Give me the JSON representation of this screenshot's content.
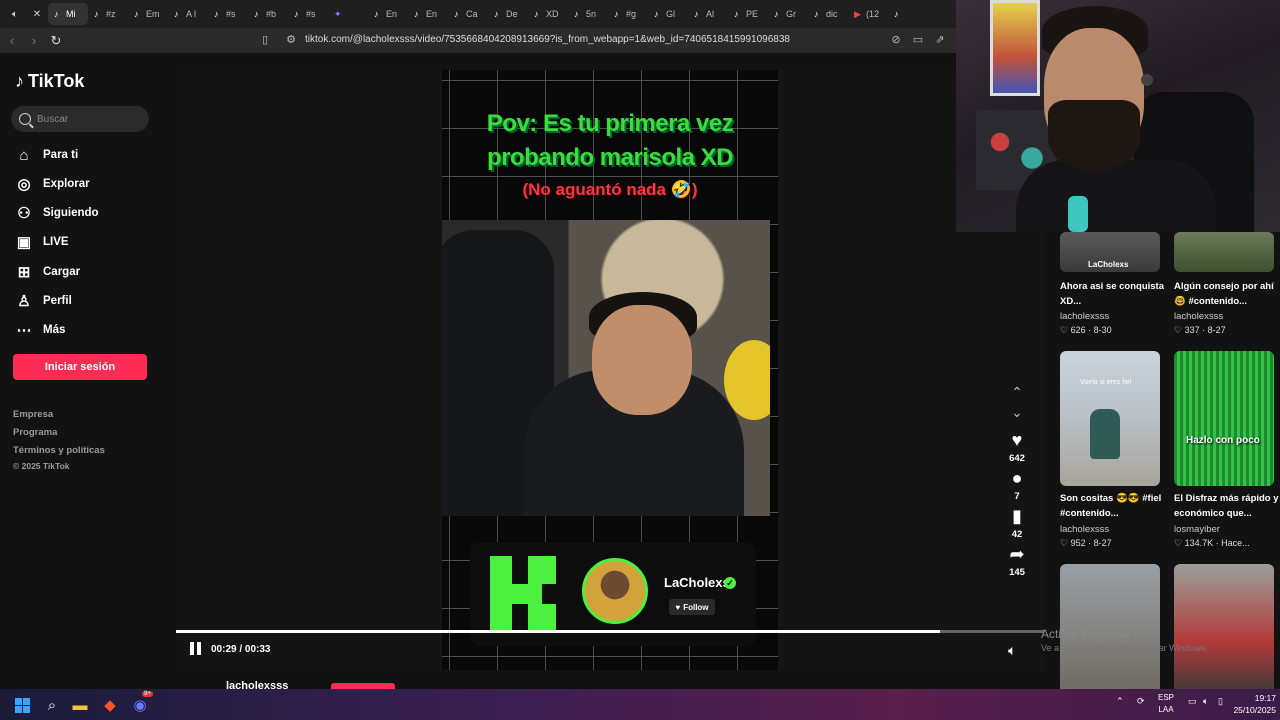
{
  "browser": {
    "tabs": [
      {
        "label": "",
        "icon": "speaker-icon"
      },
      {
        "label": "",
        "icon": "close-icon"
      },
      {
        "label": "Mi",
        "icon": "tiktok-icon",
        "active": true
      },
      {
        "label": "#z",
        "icon": "tiktok-icon"
      },
      {
        "label": "Em",
        "icon": "tiktok-icon"
      },
      {
        "label": "A l",
        "icon": "tiktok-icon"
      },
      {
        "label": "#s",
        "icon": "tiktok-icon"
      },
      {
        "label": "#b",
        "icon": "tiktok-icon"
      },
      {
        "label": "#s",
        "icon": "tiktok-icon"
      },
      {
        "label": "",
        "icon": "twitch-icon"
      },
      {
        "label": "En",
        "icon": "tiktok-icon"
      },
      {
        "label": "En",
        "icon": "tiktok-icon"
      },
      {
        "label": "Ca",
        "icon": "tiktok-icon"
      },
      {
        "label": "De",
        "icon": "tiktok-icon"
      },
      {
        "label": "XD",
        "icon": "tiktok-icon"
      },
      {
        "label": "5n",
        "icon": "tiktok-icon"
      },
      {
        "label": "#g",
        "icon": "tiktok-icon"
      },
      {
        "label": "Gl",
        "icon": "tiktok-icon"
      },
      {
        "label": "Al",
        "icon": "tiktok-icon"
      },
      {
        "label": "PE",
        "icon": "tiktok-icon"
      },
      {
        "label": "Gr",
        "icon": "tiktok-icon"
      },
      {
        "label": "dic",
        "icon": "tiktok-icon"
      },
      {
        "label": "(12",
        "icon": "youtube-icon"
      },
      {
        "label": "",
        "icon": "tiktok-icon"
      }
    ],
    "url": "tiktok.com/@lacholexsss/video/7535668404208913669?is_from_webapp=1&web_id=7406518415991096838"
  },
  "sidebar": {
    "logo": "TikTok",
    "search_placeholder": "Buscar",
    "nav": [
      {
        "label": "Para ti",
        "icon": "home-icon"
      },
      {
        "label": "Explorar",
        "icon": "compass-icon"
      },
      {
        "label": "Siguiendo",
        "icon": "following-icon"
      },
      {
        "label": "LIVE",
        "icon": "live-icon"
      },
      {
        "label": "Cargar",
        "icon": "upload-icon"
      },
      {
        "label": "Perfil",
        "icon": "profile-icon"
      },
      {
        "label": "Más",
        "icon": "more-icon"
      }
    ],
    "login_label": "Iniciar sesión",
    "footer": [
      "Empresa",
      "Programa",
      "Términos y políticas"
    ],
    "copyright": "© 2025 TikTok"
  },
  "video": {
    "overlay_line1": "Pov: Es tu primera vez",
    "overlay_line2": "probando marisola XD",
    "overlay_line3": "(No aguantó nada 🤣)",
    "channel_name": "LaCholexs",
    "follow_label": "Follow",
    "time": "00:29 / 00:33",
    "progress": 0.88,
    "likes": "642",
    "comments": "7",
    "saves": "42",
    "shares": "145",
    "bottom_user": "lacholexsss"
  },
  "recommendations": [
    {
      "title": "Ahora asi se conquista XD...",
      "user": "lacholexsss",
      "views": "626",
      "date": "8-30",
      "thumb_text": "LaCholexs"
    },
    {
      "title": "Algún consejo por ahí 🤓 #contenido...",
      "user": "lacholexsss",
      "views": "337",
      "date": "8-27",
      "thumb_text": ""
    },
    {
      "title": "Son cositas 😎😎 #fiel #contenido...",
      "user": "lacholexsss",
      "views": "952",
      "date": "8-27",
      "thumb_text": "Vuela si eres fiel"
    },
    {
      "title": "El Disfraz más rápido y económico que...",
      "user": "losmayiber",
      "views": "134.7K",
      "date": "Hace...",
      "thumb_text": "Hazlo con poco"
    }
  ],
  "windows_watermark": {
    "line1": "Activar Windows",
    "line2": "Ve a Configuración para activar Windows."
  },
  "taskbar": {
    "lang_line1": "ESP",
    "lang_line2": "LAA",
    "time": "19:17",
    "date": "25/10/2025",
    "discord_badge": "9+"
  }
}
